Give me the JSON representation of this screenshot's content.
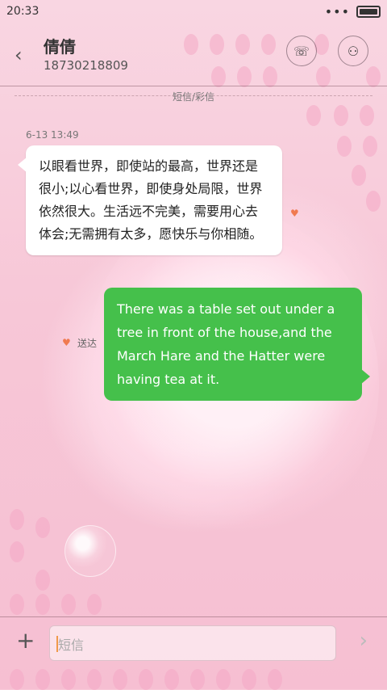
{
  "status_bar": {
    "time": "20:33",
    "more_indicator": "•••"
  },
  "header": {
    "back_icon": "‹",
    "contact_name": "倩倩",
    "contact_number": "18730218809",
    "call_icon": "☏",
    "profile_icon": "⚇"
  },
  "conversation": {
    "channel_label": "短信/彩信",
    "timestamp": "6-13 13:49",
    "incoming_message": "以眼看世界，即使站的最高，世界还是很小;以心看世界，即使身处局限，世界依然很大。生活远不完美，需要用心去体会;无需拥有太多，愿快乐与你相随。",
    "outgoing_message": "There was a table set out under a tree in front of the house,and the March Hare and the Hatter were having tea at it.",
    "delivery_status": "送达"
  },
  "composer": {
    "placeholder": "短信",
    "add_icon": "+",
    "send_icon": "›"
  },
  "colors": {
    "accent_green": "#45c04b",
    "heart_orange": "#f07a50"
  }
}
